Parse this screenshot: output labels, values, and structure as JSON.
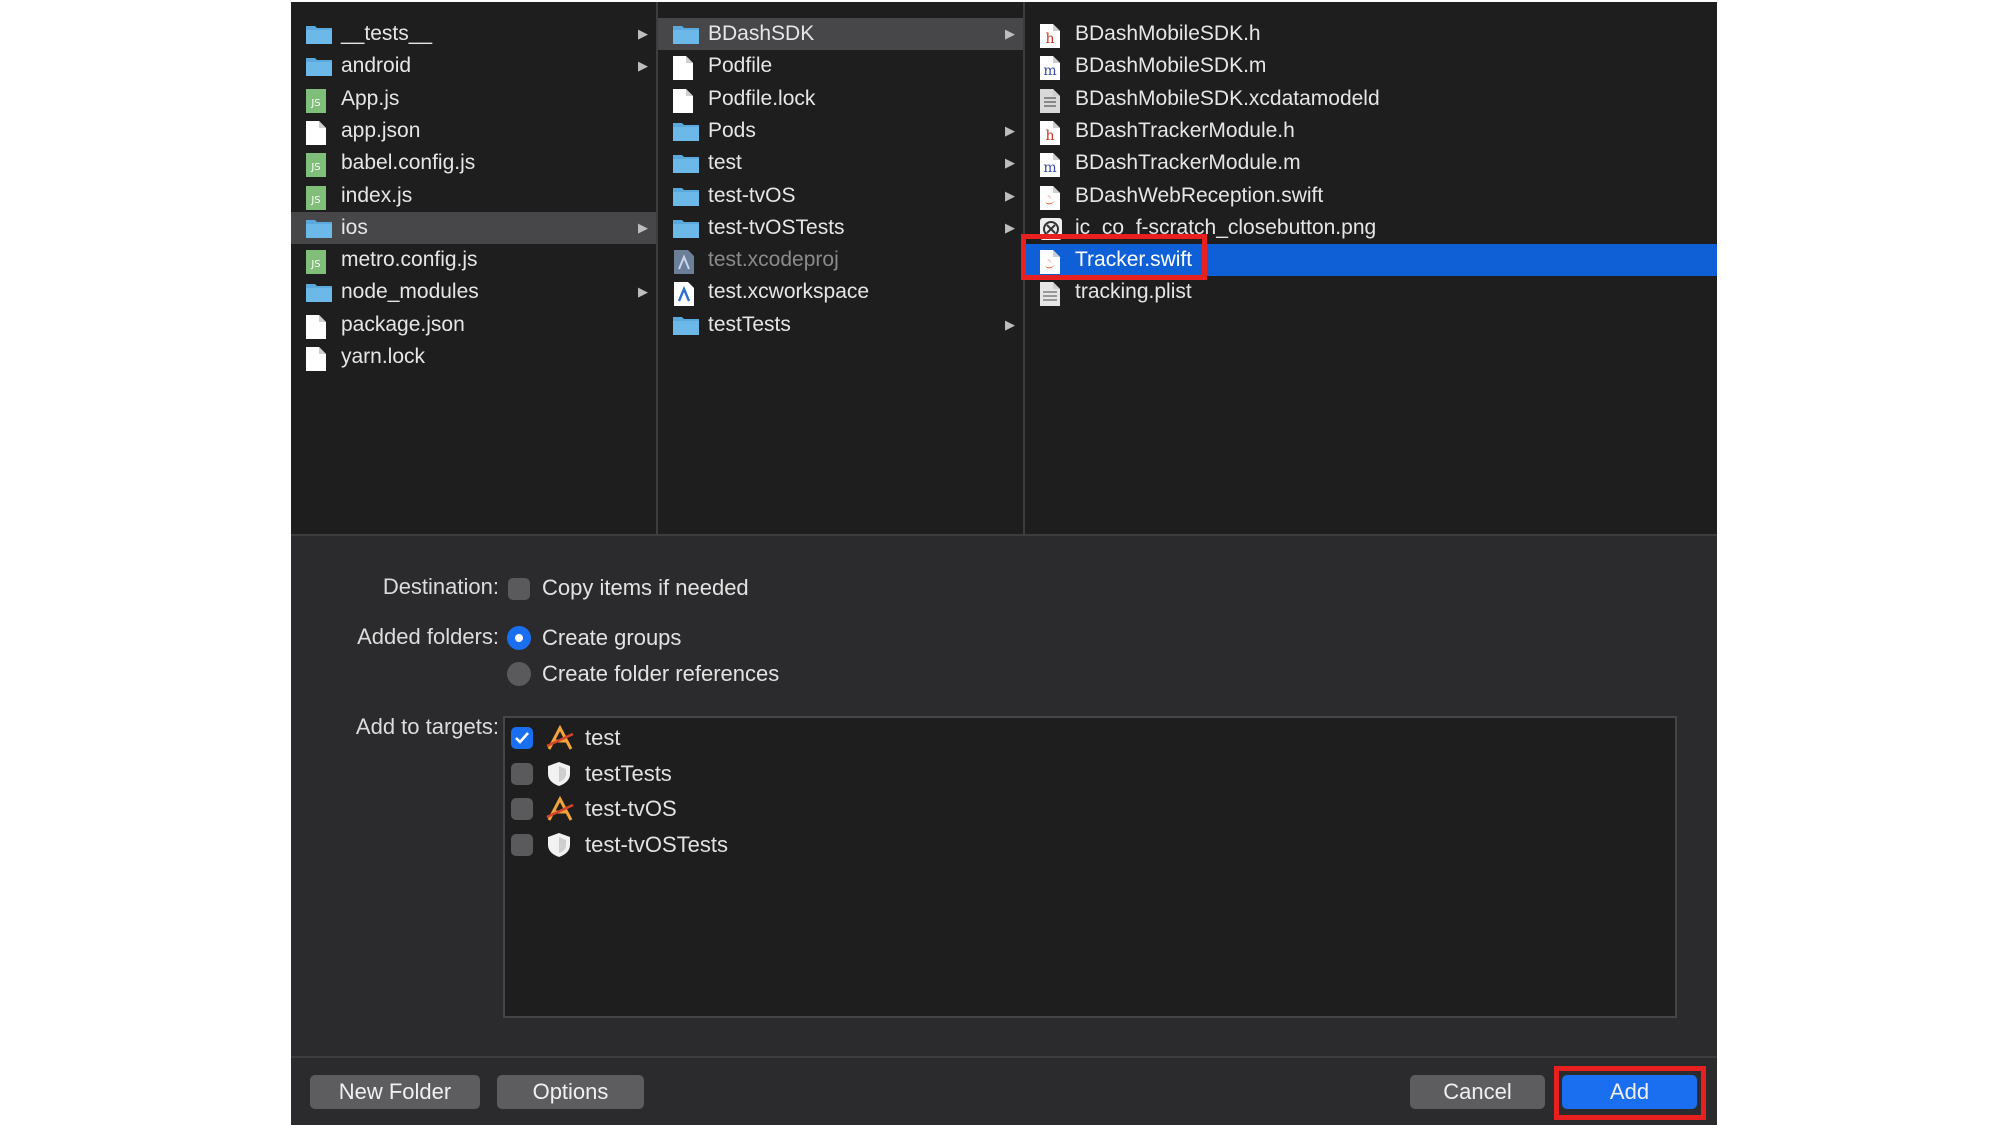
{
  "browser": {
    "column1": [
      {
        "name": "__tests__",
        "type": "folder",
        "arrow": true
      },
      {
        "name": "android",
        "type": "folder",
        "arrow": true
      },
      {
        "name": "App.js",
        "type": "js"
      },
      {
        "name": "app.json",
        "type": "file"
      },
      {
        "name": "babel.config.js",
        "type": "js"
      },
      {
        "name": "index.js",
        "type": "js"
      },
      {
        "name": "ios",
        "type": "folder",
        "arrow": true,
        "selected": true
      },
      {
        "name": "metro.config.js",
        "type": "js"
      },
      {
        "name": "node_modules",
        "type": "folder",
        "arrow": true
      },
      {
        "name": "package.json",
        "type": "file"
      },
      {
        "name": "yarn.lock",
        "type": "file"
      }
    ],
    "column2": [
      {
        "name": "BDashSDK",
        "type": "folder",
        "arrow": true,
        "selected": true
      },
      {
        "name": "Podfile",
        "type": "file"
      },
      {
        "name": "Podfile.lock",
        "type": "file"
      },
      {
        "name": "Pods",
        "type": "folder",
        "arrow": true
      },
      {
        "name": "test",
        "type": "folder",
        "arrow": true
      },
      {
        "name": "test-tvOS",
        "type": "folder",
        "arrow": true
      },
      {
        "name": "test-tvOSTests",
        "type": "folder",
        "arrow": true
      },
      {
        "name": "test.xcodeproj",
        "type": "xcodeproj",
        "dim": true
      },
      {
        "name": "test.xcworkspace",
        "type": "xcworkspace"
      },
      {
        "name": "testTests",
        "type": "folder",
        "arrow": true
      }
    ],
    "column3": [
      {
        "name": "BDashMobileSDK.h",
        "type": "h"
      },
      {
        "name": "BDashMobileSDK.m",
        "type": "m"
      },
      {
        "name": "BDashMobileSDK.xcdatamodeld",
        "type": "datamodel"
      },
      {
        "name": "BDashTrackerModule.h",
        "type": "h"
      },
      {
        "name": "BDashTrackerModule.m",
        "type": "m"
      },
      {
        "name": "BDashWebReception.swift",
        "type": "swift"
      },
      {
        "name": "ic_co_f-scratch_closebutton.png",
        "type": "png"
      },
      {
        "name": "Tracker.swift",
        "type": "swift",
        "highlighted": true
      },
      {
        "name": "tracking.plist",
        "type": "plist"
      }
    ]
  },
  "options": {
    "destination_label": "Destination:",
    "copy_items_label": "Copy items if needed",
    "added_folders_label": "Added folders:",
    "create_groups_label": "Create groups",
    "create_folder_refs_label": "Create folder references",
    "add_to_targets_label": "Add to targets:",
    "targets": [
      {
        "name": "test",
        "checked": true,
        "icon": "app-icon"
      },
      {
        "name": "testTests",
        "checked": false,
        "icon": "test-bundle-icon"
      },
      {
        "name": "test-tvOS",
        "checked": false,
        "icon": "app-icon"
      },
      {
        "name": "test-tvOSTests",
        "checked": false,
        "icon": "test-bundle-icon"
      }
    ]
  },
  "buttons": {
    "new_folder": "New Folder",
    "options": "Options",
    "cancel": "Cancel",
    "add": "Add"
  },
  "colors": {
    "selection_blue": "#0f5fd6",
    "accent_blue": "#1a6ff0",
    "annotation_red": "#e8201f"
  }
}
